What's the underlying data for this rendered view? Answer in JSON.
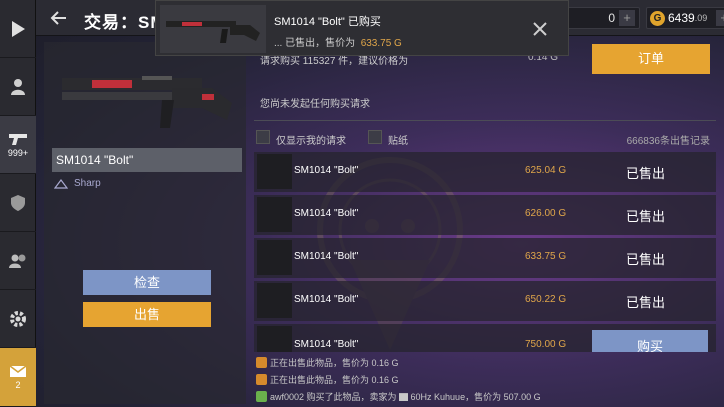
{
  "header": {
    "title": "交易：SM",
    "currency_a": "0",
    "gold_amount": "6439",
    "gold_decimal": ".09",
    "gold_symbol": "G",
    "plus": "+"
  },
  "sidebar": {
    "items": [
      {
        "icon": "play-icon"
      },
      {
        "icon": "user-icon"
      },
      {
        "icon": "gun-icon",
        "badge": "999+"
      },
      {
        "icon": "shield-icon"
      },
      {
        "icon": "friends-icon"
      },
      {
        "icon": "gear-icon"
      },
      {
        "icon": "mail-icon",
        "badge": "2"
      }
    ]
  },
  "item": {
    "name": "SM1014 \"Bolt\"",
    "quality": "Sharp",
    "inspect_label": "检查",
    "sell_label": "出售"
  },
  "requests": {
    "info": "请求购买 115327 件，建议价格为",
    "lowest_price": "0.14 G",
    "order_label": "订单",
    "no_request": "您尚未发起任何购买请求",
    "filter_mine": "仅显示我的请求",
    "filter_stickers": "贴纸",
    "sales_count": "666836条出售记录"
  },
  "listings": [
    {
      "name": "SM1014 \"Bolt\"",
      "price": "625.04 G",
      "status": "已售出"
    },
    {
      "name": "SM1014 \"Bolt\"",
      "price": "626.00 G",
      "status": "已售出"
    },
    {
      "name": "SM1014 \"Bolt\"",
      "price": "633.75 G",
      "status": "已售出"
    },
    {
      "name": "SM1014 \"Bolt\"",
      "price": "650.22 G",
      "status": "已售出"
    },
    {
      "name": "SM1014 \"Bolt\"",
      "price": "750.00 G",
      "status": "购买"
    }
  ],
  "log": [
    {
      "text": "正在出售此物品，售价为",
      "price": "0.16 G"
    },
    {
      "text": "正在出售此物品，售价为",
      "price": "0.16 G"
    },
    {
      "text": "awf0002 购买了此物品，卖家为 ▇ 60Hz Kuhuue，售价为",
      "price": "507.00 G"
    }
  ],
  "toast": {
    "title": "SM1014 \"Bolt\" 已购买",
    "body": "... 已售出，售价为",
    "price": "633.75 G"
  },
  "colors": {
    "accent_orange": "#e6a431",
    "accent_blue": "#7d95c6",
    "price_orange": "#e0a64a"
  }
}
